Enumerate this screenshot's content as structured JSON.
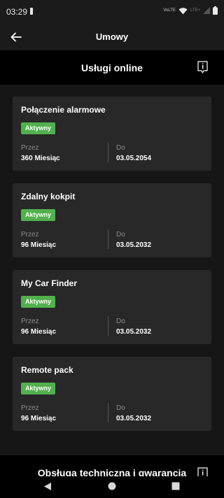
{
  "status_bar": {
    "time": "03:29",
    "volte": "VoLTE",
    "lte": "LTE+"
  },
  "header": {
    "title": "Umowy"
  },
  "section": {
    "title": "Usługi online"
  },
  "cards": [
    {
      "title": "Połączenie alarmowe",
      "status": "Aktywny",
      "period_label": "Przez",
      "period_value": "360 Miesiąc",
      "end_label": "Do",
      "end_value": "03.05.2054"
    },
    {
      "title": "Zdalny kokpit",
      "status": "Aktywny",
      "period_label": "Przez",
      "period_value": "96 Miesiąc",
      "end_label": "Do",
      "end_value": "03.05.2032"
    },
    {
      "title": "My Car Finder",
      "status": "Aktywny",
      "period_label": "Przez",
      "period_value": "96 Miesiąc",
      "end_label": "Do",
      "end_value": "03.05.2032"
    },
    {
      "title": "Remote pack",
      "status": "Aktywny",
      "period_label": "Przez",
      "period_value": "96 Miesiąc",
      "end_label": "Do",
      "end_value": "03.05.2032"
    }
  ],
  "next_section": {
    "title": "Obsługa techniczna i gwarancja"
  },
  "colors": {
    "badge": "#52b04f",
    "card": "#282828",
    "background": "#161616"
  }
}
